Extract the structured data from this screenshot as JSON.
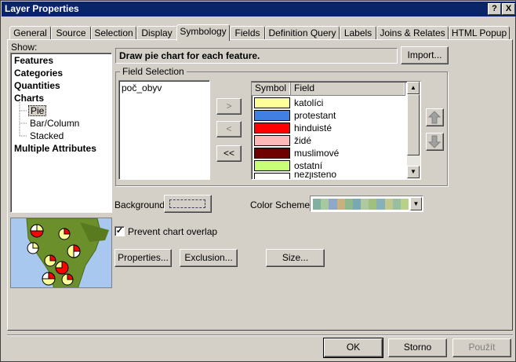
{
  "window": {
    "title": "Layer Properties",
    "help_label": "?",
    "close_label": "X"
  },
  "tabs": [
    {
      "label": "General"
    },
    {
      "label": "Source"
    },
    {
      "label": "Selection"
    },
    {
      "label": "Display"
    },
    {
      "label": "Symbology",
      "active": true
    },
    {
      "label": "Fields"
    },
    {
      "label": "Definition Query"
    },
    {
      "label": "Labels"
    },
    {
      "label": "Joins & Relates"
    },
    {
      "label": "HTML Popup"
    }
  ],
  "show": {
    "label": "Show:",
    "items": [
      {
        "label": "Features"
      },
      {
        "label": "Categories"
      },
      {
        "label": "Quantities"
      },
      {
        "label": "Charts"
      },
      {
        "label": "Pie",
        "selected": true
      },
      {
        "label": "Bar/Column"
      },
      {
        "label": "Stacked"
      },
      {
        "label": "Multiple Attributes"
      }
    ]
  },
  "description": "Draw pie chart for each feature.",
  "import_label": "Import...",
  "field_selection": {
    "legend": "Field Selection",
    "available_fields": [
      "poč_obyv"
    ],
    "move_right_label": ">",
    "move_left_label": "<",
    "move_all_left_label": "<<",
    "columns": [
      "Symbol",
      "Field"
    ],
    "rows": [
      {
        "color": "#ffff99",
        "field": "katolíci"
      },
      {
        "color": "#4080e0",
        "field": "protestant"
      },
      {
        "color": "#ff0000",
        "field": "hinduisté"
      },
      {
        "color": "#ffb8b8",
        "field": "židé"
      },
      {
        "color": "#6e0000",
        "field": "muslimové"
      },
      {
        "color": "#c8ff78",
        "field": "ostatní"
      },
      {
        "color": "#ffffff",
        "field": "nezjištěno"
      }
    ]
  },
  "background_label": "Background",
  "color_scheme_label": "Color  Scheme",
  "color_scheme_colors": [
    "#7fb0a0",
    "#a8c8a0",
    "#8fa8c8",
    "#c8b080",
    "#90b890",
    "#78a8b0",
    "#b0c8a0",
    "#a0c080",
    "#88b0b8",
    "#c0c890",
    "#98c0a0",
    "#b8d088"
  ],
  "prevent_overlap_label": "Prevent chart overlap",
  "prevent_overlap_checked": true,
  "properties_label": "Properties...",
  "exclusion_label": "Exclusion...",
  "size_label": "Size...",
  "footer": {
    "ok_label": "OK",
    "cancel_label": "Storno",
    "apply_label": "Použít"
  }
}
